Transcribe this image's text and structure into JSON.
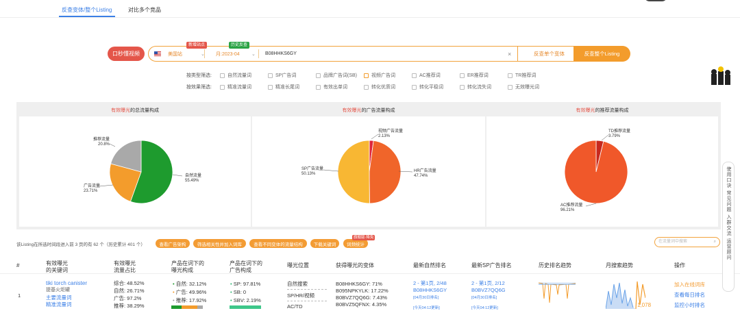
{
  "tabs": [
    {
      "label": "反查变体/整个Listing"
    },
    {
      "label": "对比多个竞品"
    }
  ],
  "search": {
    "mic_label": "口秒懂视频",
    "site_label": "美国站",
    "site_tag": "新增站点",
    "month_label": "月:2023-04",
    "month_tag": "历史反查",
    "query": "B08HHKS6GY",
    "btn_variant": "反查单个变体",
    "btn_listing": "反查整个Listing"
  },
  "filters": {
    "type_label": "按类型筛选:",
    "type_options": [
      "自然流量词",
      "SP广告词",
      "品牌广告词(SB)",
      "视频广告词",
      "AC推荐词",
      "ER推荐词",
      "TR推荐词"
    ],
    "effect_label": "按效果筛选:",
    "effect_options": [
      "精准流量词",
      "精准长尾词",
      "有效出单词",
      "转化优质词",
      "转化平稳词",
      "转化流失词",
      "无效曝光词"
    ]
  },
  "charts_titles": [
    {
      "hl": "有效曝光",
      "rest": "的总流量构成"
    },
    {
      "hl": "有效曝光",
      "rest": "的广告流量构成"
    },
    {
      "hl": "有效曝光",
      "rest": "的推荐流量构成"
    }
  ],
  "chart_data": [
    {
      "type": "pie",
      "slices": [
        {
          "label": "自然流量",
          "value": 55.49,
          "color": "#1e9b2e"
        },
        {
          "label": "广告流量",
          "value": 23.71,
          "color": "#f39c2c"
        },
        {
          "label": "推荐流量",
          "value": 20.8,
          "color": "#a9a9a9"
        }
      ]
    },
    {
      "type": "pie",
      "slices": [
        {
          "label": "视频广告流量",
          "value": 2.13,
          "color": "#e0263a"
        },
        {
          "label": "HR广告流量",
          "value": 47.74,
          "color": "#f0652a"
        },
        {
          "label": "SP广告流量",
          "value": 50.13,
          "color": "#f8b733"
        }
      ]
    },
    {
      "type": "pie",
      "slices": [
        {
          "label": "TD推荐流量",
          "value": 3.79,
          "color": "#c7291e"
        },
        {
          "label": "AC推荐流量",
          "value": 96.21,
          "color": "#f0582a"
        }
      ]
    }
  ],
  "pie_labels": {
    "c1": [
      {
        "name": "推荐流量",
        "pct": "20.8%"
      },
      {
        "name": "广告流量",
        "pct": "23.71%"
      },
      {
        "name": "自然流量",
        "pct": "55.49%"
      }
    ],
    "c2": [
      {
        "name": "视频广告流量",
        "pct": "2.13%"
      },
      {
        "name": "SP广告流量",
        "pct": "50.13%"
      },
      {
        "name": "HR广告流量",
        "pct": "47.74%"
      }
    ],
    "c3": [
      {
        "name": "TD推荐流量",
        "pct": "3.79%"
      },
      {
        "name": "AC推荐流量",
        "pct": "96.21%"
      }
    ]
  },
  "summary": "该Listing在所选时间段进入前 3 页的有 62 个（历史累计 401 个）",
  "actions": [
    {
      "label": "查看广告架构"
    },
    {
      "label": "筛选相关性并加入词库"
    },
    {
      "label": "查看不同变体的流量结构"
    },
    {
      "label": "下载关键词"
    },
    {
      "label": "词频统计"
    }
  ],
  "actions_tag": "旗舰版·降免",
  "table_search_placeholder": "在流量词中搜索",
  "columns": [
    "#",
    "有效曝光\n的关键词",
    "有效曝光\n流量占比",
    "产品在词下的\n曝光构成",
    "产品在词下的\n广告构成",
    "曝光位置",
    "获得曝光的变体",
    "最新自然排名",
    "最新SP广告排名",
    "历史排名趋势",
    "月搜索趋势",
    "操作"
  ],
  "row": {
    "index": "1",
    "keyword": "tiki torch canister",
    "keyword_cn": "提基火炬罐",
    "kw_links": [
      "主要流量词",
      "精准流量词"
    ],
    "share": [
      "综合: 48.52%",
      "自然: 26.71%",
      "广告: 97.2%",
      "推荐: 38.29%"
    ],
    "exposure": [
      "自然: 32.12%",
      "广告: 49.96%",
      "推荐: 17.92%"
    ],
    "ads": [
      "SP: 97.81%",
      "SB: 0",
      "SBV: 2.19%"
    ],
    "positions": [
      "自然搜索",
      "SP/HR/视频",
      "AC/TD"
    ],
    "variants": [
      "B08HHKS6GY: 71%",
      "B095NPKYLK: 17.22%",
      "B0BVZ7QQ6G: 7.43%",
      "B0BVZ5QFNX: 4.35%"
    ],
    "nat_rank": "2 - 第1页, 2/48",
    "nat_asin": "B08HHKS6GY",
    "nat_date": "[04月30日排名]",
    "nat_upd": "[今天04:12更新]",
    "sp_rank": "2 - 第1页, 2/12",
    "sp_asin": "B0BVZ7QQ6G",
    "sp_date": "[04月30日排名]",
    "sp_upd": "[今天04:12更新]",
    "search_vol": "1,078",
    "ops": [
      "加入在线词库",
      "查看每日排名",
      "监控小时排名"
    ]
  },
  "sidebar_label": "使用口诀 常见问题 入群交流 运营顾问"
}
